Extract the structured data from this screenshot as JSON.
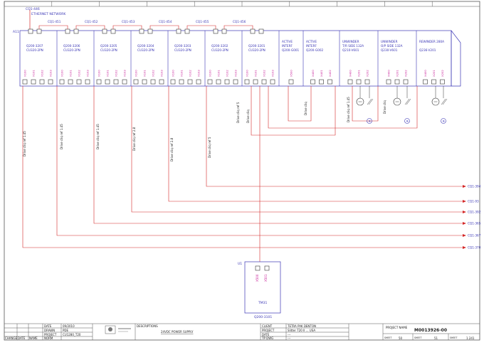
{
  "colors": {
    "frame": "#555555",
    "module_text": "#3a36b5",
    "port_text": "#c8209a",
    "wire": "#d42828",
    "diag_text": "#222222"
  },
  "top_ref": "CQ1-446",
  "network_label": "ETHERNET NETWORK",
  "rack_label": "A11",
  "ring_labels": [
    "CQ1-451",
    "CQ1-452",
    "CQ1-453",
    "CQ1-454",
    "CQ1-455",
    "CQ1-456"
  ],
  "modules": [
    {
      "name": "Q200-3207",
      "type": "CU320-2PN",
      "ports": [
        "X100",
        "X101",
        "X102",
        "X103"
      ]
    },
    {
      "name": "Q200-3206",
      "type": "CU320-2PN",
      "ports": [
        "X100",
        "X101",
        "X102",
        "X103"
      ]
    },
    {
      "name": "Q200-3205",
      "type": "CU320-2PN",
      "ports": [
        "X100",
        "X101",
        "X102",
        "X103"
      ]
    },
    {
      "name": "Q200-3204",
      "type": "CU320-2PN",
      "ports": [
        "X100",
        "X101",
        "X102",
        "X103"
      ]
    },
    {
      "name": "Q200-3203",
      "type": "CU320-2PN",
      "ports": [
        "X100",
        "X101",
        "X102",
        "X103"
      ]
    },
    {
      "name": "Q200-3202",
      "type": "CU320-2PN",
      "ports": [
        "X100",
        "X101",
        "X102",
        "X103"
      ]
    },
    {
      "name": "Q200-3201",
      "type": "CU320-2PN",
      "ports": [
        "X100",
        "X101",
        "X102",
        "X103"
      ]
    },
    {
      "name1": "ACTIVE",
      "name2": "INTERF",
      "code": "Q200-G001",
      "ports": [
        "X500"
      ]
    },
    {
      "name1": "ACTIVE",
      "name2": "INTERF",
      "code": "Q200-G002",
      "ports": [
        "X400",
        "X401",
        "X402"
      ]
    },
    {
      "name1": "UNWINDER",
      "name2": "T/R SIDE 132A",
      "code": "Q210-V601",
      "ports": [
        "X400",
        "X201",
        "X202"
      ]
    },
    {
      "name1": "UNWINDER",
      "name2": "O/P SIDE 132A",
      "code": "Q230-V601",
      "ports": [
        "X400",
        "X201",
        "X202"
      ]
    },
    {
      "name1": "REWINDER 280A",
      "name2": "",
      "code": "Q236-V201",
      "ports": [
        "X400",
        "X201",
        "X202"
      ]
    }
  ],
  "drive_labels": [
    "Drive cliq ref 1.45",
    "Drive cliq ref 1.45",
    "Drive cliq ref 1.45",
    "Drive cliq ref 2.8",
    "Drive cliq ref 2.8",
    "Drive cliq ref 5",
    "Drive cliq ref 5",
    "Drive cliq",
    "Drive cliq",
    "Drive cliq ref 1.45",
    "Drive cliq"
  ],
  "cross_refs": [
    "CQ1-394",
    "CQ1-93",
    "CQ1-392",
    "CQ1-365",
    "CQ1-367",
    "CQ1-370"
  ],
  "tm": {
    "unit_ref": "U1",
    "name": "TM31",
    "code": "Q200-3101",
    "ports": [
      "X500",
      "X501"
    ]
  },
  "title_block": {
    "date_label": "DATE",
    "date_value": "09/2010",
    "drawn_label": "DRAWN",
    "drawn_value": "PDE",
    "project_label": "PROJECT",
    "project_value": "CU1280_T20",
    "norm_label": "NORM",
    "change_label": "CHANGE",
    "date2_label": "DATE",
    "name_label": "NAME",
    "descriptions_label": "DESCRIPTIONS",
    "description": "24VDC POWER SUPPLY",
    "client_label": "CLIENT",
    "client_value": "TETRA PAK DENTON",
    "project2_label": "PROJECT",
    "project2_value": "Slitter T20 II ... USA",
    "date3_label": "DATE",
    "date3_value": "---",
    "tpdwg_label": "TP DWG",
    "tpdwg_value": "---",
    "project_name_label": "PROJECT NAME",
    "project_name": "M0013926-00",
    "sheet_label": "SHEET",
    "sheet_value": "50",
    "sheet2_label": "SHEET",
    "sheet2_value": "51",
    "sheet3_label": "SHEET",
    "sheet3_value": "1.241"
  }
}
